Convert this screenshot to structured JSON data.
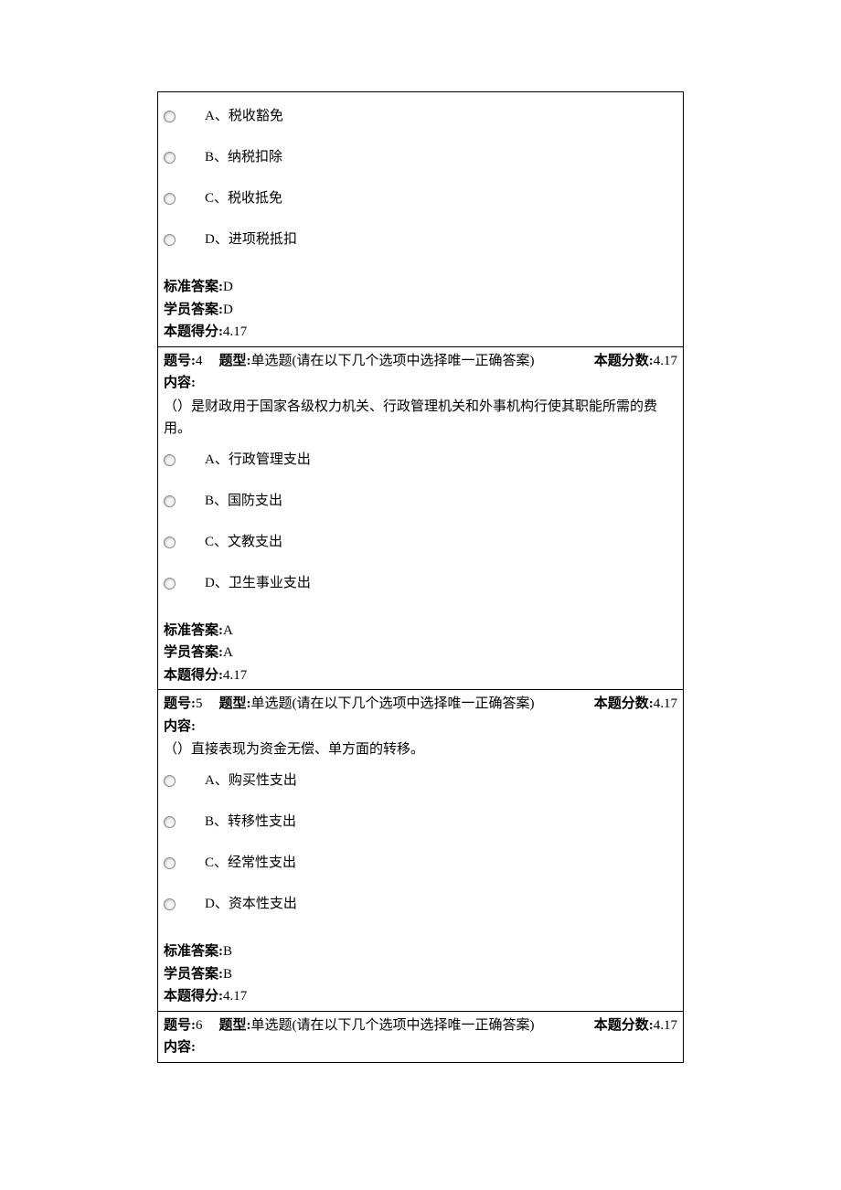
{
  "labels": {
    "question_number": "题号:",
    "question_type": "题型:",
    "question_score": "本题分数:",
    "content": "内容:",
    "standard_answer": "标准答案:",
    "student_answer": "学员答案:",
    "score_obtained": "本题得分:"
  },
  "type_text": "单选题(请在以下几个选项中选择唯一正确答案)",
  "questions": [
    {
      "number": "",
      "options": [
        "A、税收豁免",
        "B、纳税扣除",
        "C、税收抵免",
        "D、进项税抵扣"
      ],
      "standard_answer": "D",
      "student_answer": "D",
      "score_obtained": "4.17"
    },
    {
      "number": "4",
      "score": "4.17",
      "content": "（）是财政用于国家各级权力机关、行政管理机关和外事机构行使其职能所需的费用。",
      "options": [
        "A、行政管理支出",
        "B、国防支出",
        "C、文教支出",
        "D、卫生事业支出"
      ],
      "standard_answer": "A",
      "student_answer": "A",
      "score_obtained": "4.17"
    },
    {
      "number": "5",
      "score": "4.17",
      "content": "（）直接表现为资金无偿、单方面的转移。",
      "options": [
        "A、购买性支出",
        "B、转移性支出",
        "C、经常性支出",
        "D、资本性支出"
      ],
      "standard_answer": "B",
      "student_answer": "B",
      "score_obtained": "4.17"
    },
    {
      "number": "6",
      "score": "4.17",
      "content": ""
    }
  ]
}
